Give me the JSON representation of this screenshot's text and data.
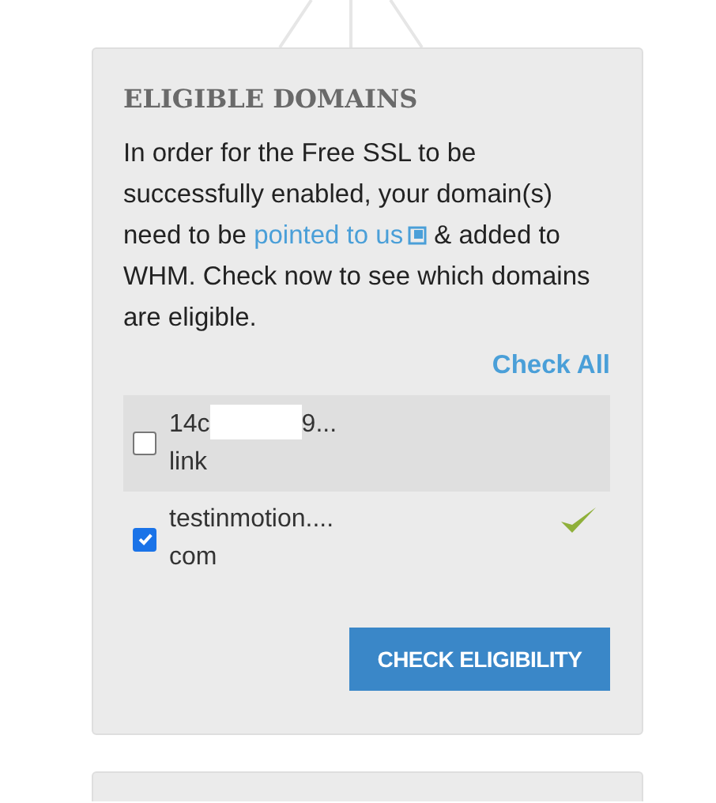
{
  "card": {
    "title": "ELIGIBLE DOMAINS",
    "description": "In order for the Free SSL to be successfully enabled, your domain(s) need to be ",
    "link": "pointed to us",
    "description_end": " & added to WHM. Check now to see which domains are eligible.",
    "check_all": "Check All",
    "domains": [
      {
        "name_start": "14c",
        "redacted": true,
        "name_end": "9...",
        "name_line2": "link",
        "checked": false,
        "highlighted": true,
        "eligible": false
      },
      {
        "name_start": "testinmotion....",
        "redacted": false,
        "name_line2": "com",
        "checked": true,
        "highlighted": false,
        "eligible": true
      }
    ],
    "button": "CHECK ELIGIBILITY"
  }
}
